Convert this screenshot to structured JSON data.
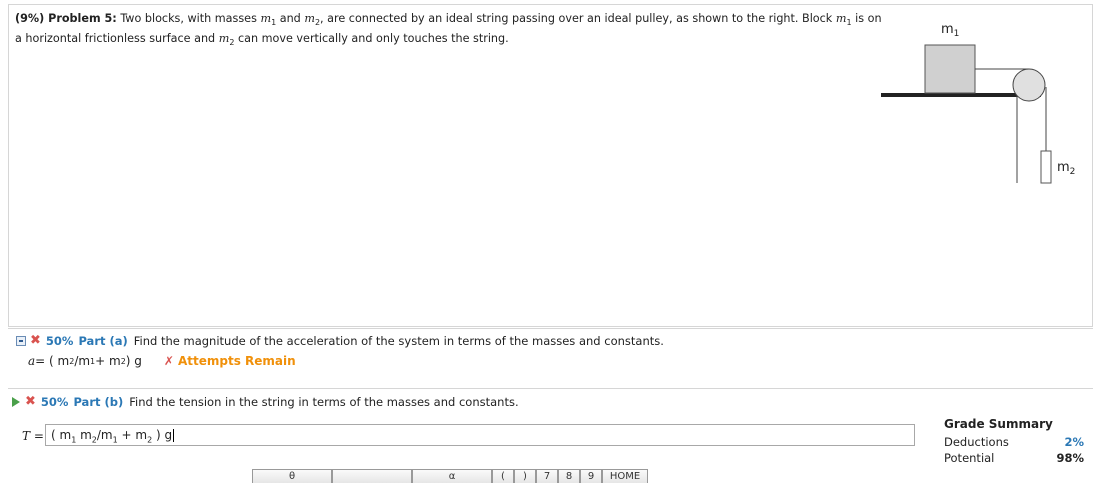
{
  "problem": {
    "number_label": "(9%)  Problem 5:",
    "text_1": "Two blocks, with masses ",
    "m1_var": "m",
    "m1_sub": "1",
    "text_2": " and ",
    "m2_var": "m",
    "m2_sub": "2",
    "text_3": ", are connected by an ideal string passing over an ideal pulley, as shown to the right. Block ",
    "text_4": " is on a horizontal frictionless surface and ",
    "text_5": " can move vertically and only touches the string."
  },
  "diagram": {
    "label_m1": "m",
    "label_m1_sub": "1",
    "label_m2": "m",
    "label_m2_sub": "2"
  },
  "part_a": {
    "percent": "50%",
    "label": "Part (a)",
    "text": "Find the magnitude of the acceleration of the system in terms of the masses and constants.",
    "answer_var": "a",
    "answer_expr_1": " = ( m",
    "answer_expr_2": "/m",
    "answer_expr_3": " + m",
    "answer_expr_4": " ) g",
    "sub_2": "2",
    "sub_1": "1",
    "attempts_mark": "✗",
    "attempts_text": "Attempts Remain"
  },
  "part_b": {
    "percent": "50%",
    "label": "Part (b)",
    "text": "Find the tension in the string in terms of the masses and constants.",
    "answer_var": "T",
    "answer_eq": " =",
    "input_1": "( m",
    "input_2": " m",
    "input_3": "/m",
    "input_4": " + m",
    "input_5": " ) g",
    "sub_1": "1",
    "sub_2": "2"
  },
  "grade_summary": {
    "title": "Grade Summary",
    "deductions_label": "Deductions",
    "deductions_value": "2%",
    "potential_label": "Potential",
    "potential_value": "98%"
  },
  "keypad": {
    "keys": [
      "θ",
      "",
      "α",
      "(",
      ")",
      "7",
      "8",
      "9",
      "HOME"
    ]
  },
  "colors": {
    "accent_blue": "#2b78b5",
    "attempts_orange": "#f0900a",
    "error_red": "#d9534f"
  }
}
